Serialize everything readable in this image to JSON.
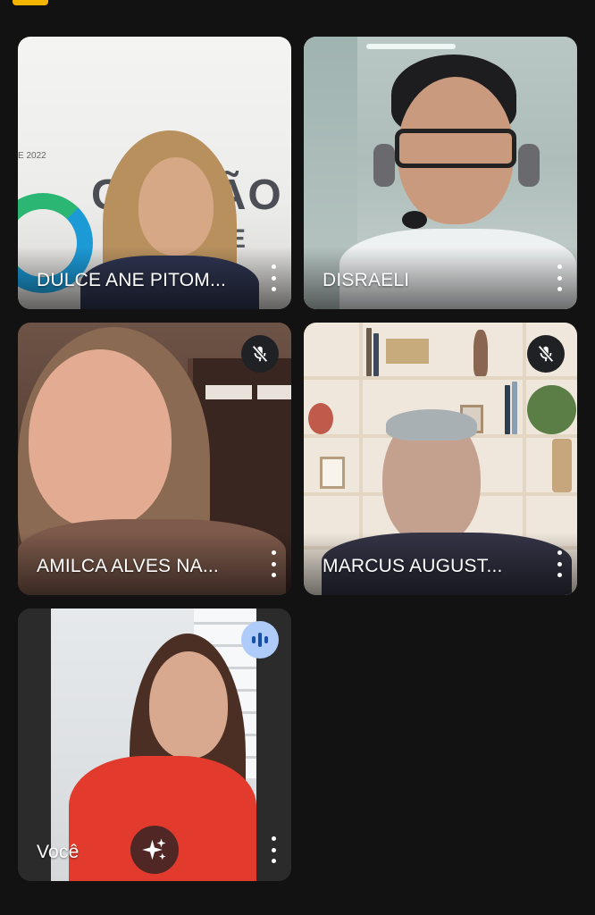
{
  "participants": [
    {
      "name": "DULCE ANE PITOM...",
      "muted": false
    },
    {
      "name": "DISRAELI",
      "muted": false
    },
    {
      "name": "AMILCA ALVES NA...",
      "muted": true
    },
    {
      "name": "MARCUS AUGUST...",
      "muted": true
    },
    {
      "name": "Você",
      "muted": false,
      "speaking": true,
      "is_self": true
    }
  ],
  "backdrop": {
    "text_main": "GESTÃO",
    "text_sub": "SAÚDE PÚBLI",
    "year": "E 2022"
  },
  "colors": {
    "background": "#121212",
    "top_badge": "#f4b400",
    "speaking_bg": "#aecbfa",
    "speaking_fg": "#174ea6",
    "mic_off_bg": "#202124"
  },
  "icons": {
    "more": "more-vert-icon",
    "mic_off": "mic-off-icon",
    "speaking": "audio-level-icon",
    "effects": "sparkle-icon"
  }
}
